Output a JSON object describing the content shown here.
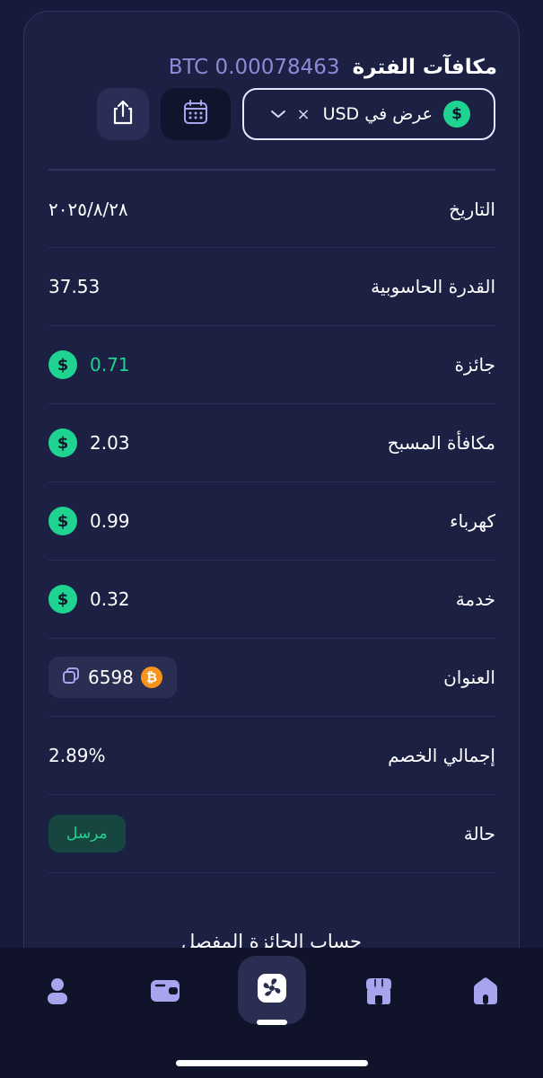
{
  "header": {
    "title": "مكافآت الفترة",
    "amount": "BTC 0.00078463"
  },
  "controls": {
    "view_label": "عرض في USD",
    "clear_symbol": "×",
    "currency_symbol": "$"
  },
  "rows": [
    {
      "label": "التاريخ",
      "value": "٢٠٢٥/٨/٢٨"
    },
    {
      "label": "القدرة الحاسوبية",
      "value": "37.53"
    },
    {
      "label": "جائزة",
      "value": "0.71",
      "icon": "dollar-icon"
    },
    {
      "label": "مكافأة المسبح",
      "value": "2.03",
      "icon": "dollar-icon"
    },
    {
      "label": "كهرباء",
      "value": "0.99",
      "icon": "dollar-icon"
    },
    {
      "label": "خدمة",
      "value": "0.32",
      "icon": "dollar-icon"
    },
    {
      "label": "العنوان",
      "value": "6598",
      "icon": "bitcoin-icon"
    },
    {
      "label": "إجمالي الخصم",
      "value": "2.89%"
    },
    {
      "label": "حالة",
      "value": "مرسل"
    }
  ],
  "btc_symbol": "₿",
  "detail_link": "حساب الجائزة المفصل",
  "nav": {
    "items": [
      "profile-icon",
      "wallet-icon",
      "miner-fan-icon",
      "shop-icon",
      "home-icon"
    ],
    "active": "miner-fan-icon"
  },
  "colors": {
    "background": "#171a3a",
    "card": "#1c2043",
    "accent_green": "#1ed490",
    "accent_purple": "#8f8ad8",
    "bitcoin_orange": "#f7931a"
  }
}
